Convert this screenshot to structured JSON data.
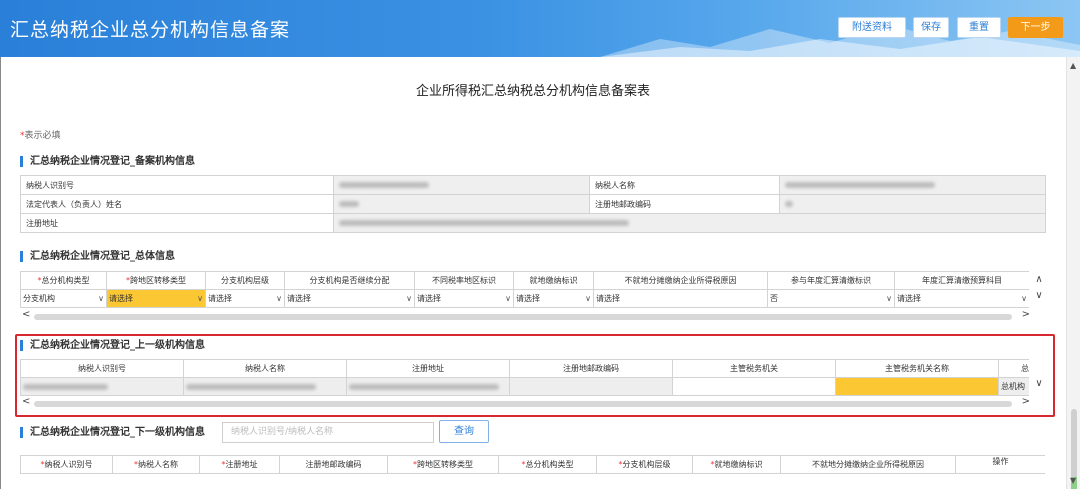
{
  "header": {
    "title": "汇总纳税企业总分机构信息备案",
    "buttons": {
      "attach": "附送资料",
      "save": "保存",
      "reset": "重置",
      "next": "下一步"
    }
  },
  "page_title": "企业所得税汇总纳税总分机构信息备案表",
  "required_note": {
    "star": "*",
    "text": "表示必填"
  },
  "section_filing": {
    "title": "汇总纳税企业情况登记_备案机构信息",
    "rows": [
      {
        "label1": "纳税人识别号",
        "label2": "纳税人名称"
      },
      {
        "label1": "法定代表人（负责人）姓名",
        "label2": "注册地邮政编码"
      },
      {
        "label1": "注册地址"
      }
    ]
  },
  "section_general": {
    "title": "汇总纳税企业情况登记_总体信息",
    "columns": [
      {
        "star": "*",
        "label": "总分机构类型"
      },
      {
        "star": "*",
        "label": "跨地区转移类型"
      },
      {
        "star": "",
        "label": "分支机构层级"
      },
      {
        "star": "",
        "label": "分支机构是否继续分配"
      },
      {
        "star": "",
        "label": "不同税率地区标识"
      },
      {
        "star": "",
        "label": "就地缴纳标识"
      },
      {
        "star": "",
        "label": "不就地分摊缴纳企业所得税原因"
      },
      {
        "star": "",
        "label": "参与年度汇算清缴标识"
      },
      {
        "star": "",
        "label": "年度汇算清缴预算科目"
      }
    ],
    "values": [
      "分支机构",
      "请选择",
      "请选择",
      "请选择",
      "请选择",
      "请选择",
      "请选择",
      "否",
      "请选择"
    ]
  },
  "section_parent": {
    "title": "汇总纳税企业情况登记_上一级机构信息",
    "columns": [
      "纳税人识别号",
      "纳税人名称",
      "注册地址",
      "注册地邮政编码",
      "主管税务机关",
      "主管税务机关名称",
      "总"
    ],
    "last_value": "总机构"
  },
  "section_child": {
    "title": "汇总纳税企业情况登记_下一级机构信息",
    "search_placeholder": "纳税人识别号/纳税人名称",
    "query_label": "查询",
    "columns": [
      {
        "star": "*",
        "label": "纳税人识别号"
      },
      {
        "star": "*",
        "label": "纳税人名称"
      },
      {
        "star": "*",
        "label": "注册地址"
      },
      {
        "star": "",
        "label": "注册地邮政编码"
      },
      {
        "star": "*",
        "label": "跨地区转移类型"
      },
      {
        "star": "*",
        "label": "总分机构类型"
      },
      {
        "star": "*",
        "label": "分支机构层级"
      },
      {
        "star": "*",
        "label": "就地缴纳标识"
      },
      {
        "star": "",
        "label": "不就地分摊缴纳企业所得税原因"
      },
      {
        "star": "",
        "label": "操作"
      }
    ]
  },
  "icons": {
    "chevron": "chevron-down-icon",
    "scroll_up": "scroll-up-icon",
    "scroll_down": "scroll-down-icon"
  },
  "colors": {
    "brand": "#2a7fd8",
    "next_button": "#f39a19",
    "highlight": "#fbc732",
    "alert_box": "#d8282f"
  }
}
